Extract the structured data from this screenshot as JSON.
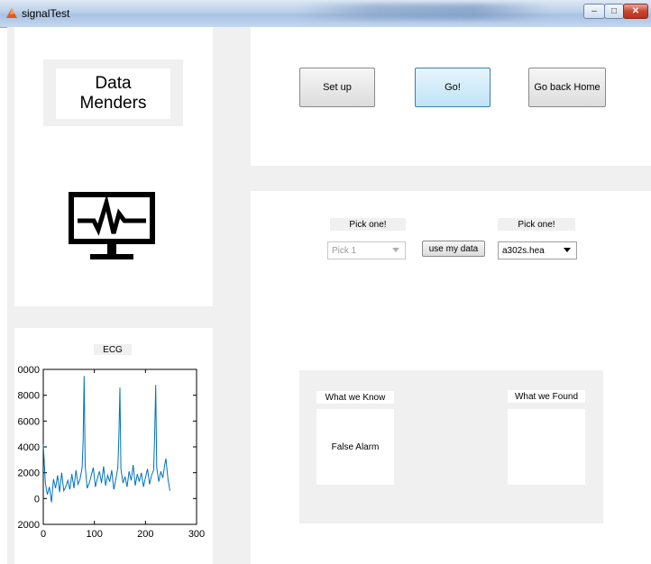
{
  "window": {
    "title": "signalTest"
  },
  "logo": {
    "line1": "Data",
    "line2": "Menders"
  },
  "buttons": {
    "setup": "Set up",
    "go": "Go!",
    "home": "Go back Home",
    "use_my_data": "use my data"
  },
  "pickers": {
    "left_label": "Pick one!",
    "left_value": "Pick 1",
    "right_label": "Pick one!",
    "right_value": "a302s.hea"
  },
  "results": {
    "know_label": "What we Know",
    "know_value": "False Alarm",
    "found_label": "What we Found",
    "found_value": ""
  },
  "chart_data": {
    "type": "line",
    "title": "ECG",
    "xlabel": "",
    "ylabel": "",
    "xlim": [
      0,
      300
    ],
    "ylim": [
      -2000,
      10000
    ],
    "xticks": [
      "0",
      "100",
      "200",
      "300"
    ],
    "yticks": [
      "0000",
      "8000",
      "6000",
      "4000",
      "2000",
      "0",
      "2000"
    ],
    "color": "#0072bd",
    "series": [
      {
        "x": [
          0,
          4,
          8,
          12,
          16,
          20,
          24,
          28,
          32,
          36,
          40,
          44,
          48,
          52,
          56,
          60,
          64,
          68,
          72,
          76,
          78,
          80,
          82,
          86,
          90,
          94,
          98,
          102,
          106,
          110,
          114,
          118,
          122,
          126,
          130,
          134,
          138,
          142,
          146,
          148,
          150,
          152,
          156,
          160,
          164,
          168,
          172,
          176,
          180,
          184,
          188,
          192,
          196,
          200,
          204,
          208,
          212,
          216,
          218,
          220,
          222,
          226,
          230,
          234,
          238,
          240,
          244,
          248
        ],
        "values": [
          4200,
          1200,
          300,
          900,
          -300,
          1500,
          800,
          1800,
          500,
          2000,
          600,
          900,
          1400,
          700,
          1900,
          800,
          2200,
          1100,
          1500,
          2400,
          4500,
          9500,
          2500,
          800,
          1200,
          1800,
          2400,
          900,
          1600,
          2100,
          1200,
          2500,
          1000,
          1800,
          1300,
          2200,
          700,
          1500,
          2400,
          5000,
          8600,
          2300,
          1200,
          1700,
          900,
          2100,
          1400,
          2600,
          1000,
          1900,
          1300,
          2000,
          900,
          1600,
          2300,
          1100,
          1800,
          2200,
          4800,
          8800,
          2400,
          1300,
          2100,
          1600,
          2700,
          3100,
          1500,
          600
        ]
      }
    ]
  }
}
